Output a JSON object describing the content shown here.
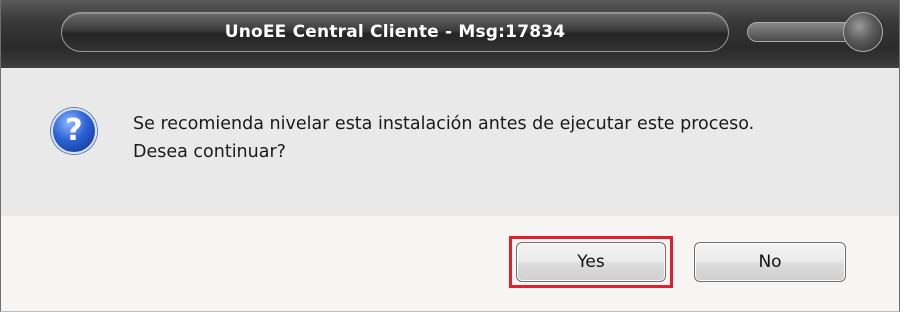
{
  "window": {
    "title": "UnoEE Central Cliente - Msg:17834"
  },
  "dialog": {
    "icon": "question-icon",
    "message_line1": "Se recomienda nivelar esta instalación antes de ejecutar este proceso.",
    "message_line2": "Desea continuar?"
  },
  "buttons": {
    "yes_label": "Yes",
    "no_label": "No"
  },
  "colors": {
    "highlight": "#e0202a",
    "titlebar": "#2a2a2a"
  }
}
